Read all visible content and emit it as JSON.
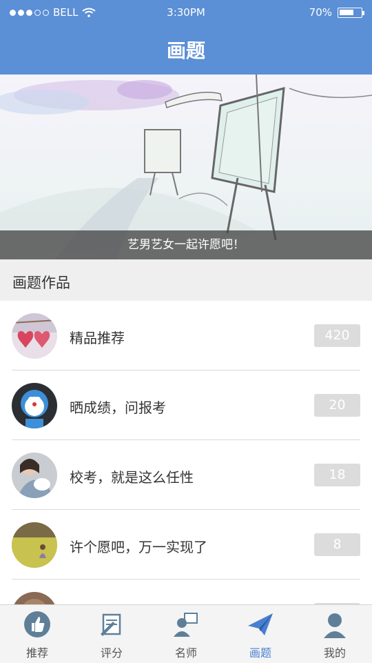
{
  "status_bar": {
    "carrier": "BELL",
    "time": "3:30PM",
    "battery": "70%",
    "battery_level": 0.7
  },
  "header": {
    "title": "画题"
  },
  "banner": {
    "caption": "艺男艺女一起许愿吧！"
  },
  "section": {
    "title": "画题作品"
  },
  "items": [
    {
      "label": "精品推荐",
      "count": "420"
    },
    {
      "label": "晒成绩，问报考",
      "count": "20"
    },
    {
      "label": "校考，就是这么任性",
      "count": "18"
    },
    {
      "label": "许个愿吧，万一实现了",
      "count": "8"
    },
    {
      "label": "",
      "count": ""
    }
  ],
  "tabs": [
    {
      "label": "推荐",
      "icon": "thumbs-up-icon"
    },
    {
      "label": "评分",
      "icon": "paper-pen-icon"
    },
    {
      "label": "名师",
      "icon": "teacher-icon"
    },
    {
      "label": "画题",
      "icon": "paper-plane-icon"
    },
    {
      "label": "我的",
      "icon": "user-icon"
    }
  ],
  "colors": {
    "accent": "#5b8fd6",
    "active_tab": "#4a7fd0",
    "count_badge": "#dcdcdc"
  }
}
